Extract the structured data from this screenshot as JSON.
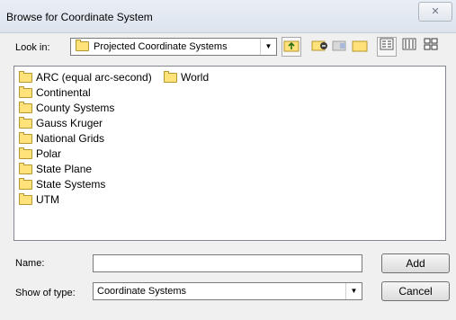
{
  "window": {
    "title": "Browse for Coordinate System",
    "close_glyph": "✕"
  },
  "lookin": {
    "label": "Look in:",
    "value": "Projected Coordinate Systems",
    "folder_icon": "folder-icon"
  },
  "toolbar": {
    "icons": [
      "up-one-level-icon",
      "connect-folder-icon",
      "disconnect-folder-icon",
      "new-folder-icon",
      "list-view-icon",
      "details-view-icon",
      "thumbnails-view-icon"
    ]
  },
  "list": {
    "items": [
      {
        "label": "ARC (equal arc-second)",
        "icon": "folder-icon"
      },
      {
        "label": "World",
        "icon": "folder-icon"
      },
      {
        "label": "Continental",
        "icon": "folder-icon"
      },
      {
        "label": "County Systems",
        "icon": "folder-icon"
      },
      {
        "label": "Gauss Kruger",
        "icon": "folder-icon"
      },
      {
        "label": "National Grids",
        "icon": "folder-icon"
      },
      {
        "label": "Polar",
        "icon": "folder-icon"
      },
      {
        "label": "State Plane",
        "icon": "folder-icon"
      },
      {
        "label": "State Systems",
        "icon": "folder-icon"
      },
      {
        "label": "UTM",
        "icon": "folder-icon"
      }
    ]
  },
  "form": {
    "name_label": "Name:",
    "name_value": "",
    "type_label": "Show of type:",
    "type_value": "Coordinate Systems"
  },
  "buttons": {
    "add": "Add",
    "cancel": "Cancel"
  }
}
